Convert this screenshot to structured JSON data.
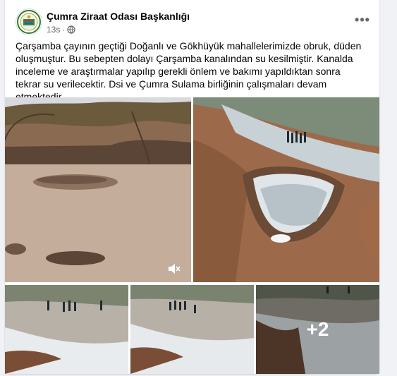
{
  "post": {
    "page_name": "Çumra Ziraat Odası Başkanlığı",
    "time": "13s",
    "separator": "·",
    "audience_icon": "globe-icon",
    "more_icon": "more-options-icon",
    "more_label": "•••",
    "text": "Çarşamba çayının geçtiği Doğanlı ve Gökhüyük mahallelerimizde obruk, düden oluşmuştur. Bu sebepten dolayı Çarşamba kanalından su kesilmiştir. Kanalda inceleme ve araştırmalar yapılıp gerekli önlem ve bakımı yapıldıktan sonra tekrar su verilecektir. Dsi ve Çumra Sulama birliğinin çalışmaları devam etmektedir."
  },
  "media": {
    "more_count": "+2",
    "volume_icon": "volume-muted-icon"
  },
  "colors": {
    "text": "#050505",
    "secondary": "#65676b",
    "background": "#f0f2f5"
  }
}
